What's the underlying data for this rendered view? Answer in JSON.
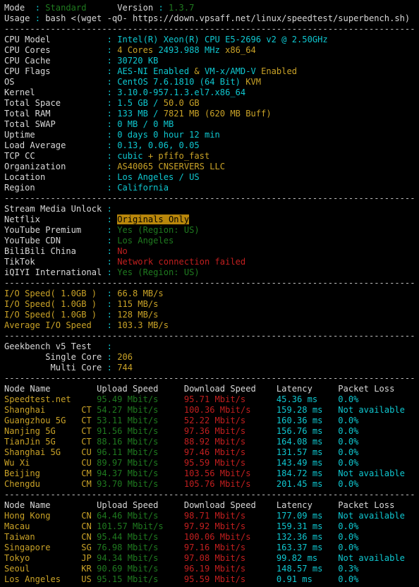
{
  "terminal": {
    "separator": "--------------------------------------------------------------------------------",
    "header": {
      "mode_label": "Mode  ",
      "mode_value": "Standard",
      "version_label": "Version ",
      "version_value": "1.3.7",
      "usage_label": "Usage ",
      "usage_value": "bash <(wget -qO- https://down.vpsaff.net/linux/speedtest/superbench.sh)"
    },
    "system": {
      "rows": [
        {
          "label": "CPU Model",
          "segments": [
            {
              "text": "Intel(R) Xeon(R) CPU E5-2696 v2 @ 2.50GHz",
              "color": "cyan"
            }
          ]
        },
        {
          "label": "CPU Cores",
          "segments": [
            {
              "text": "4 Cores ",
              "color": "yellow"
            },
            {
              "text": "2493.988 MHz ",
              "color": "cyan"
            },
            {
              "text": "x86_64",
              "color": "yellow"
            }
          ]
        },
        {
          "label": "CPU Cache",
          "segments": [
            {
              "text": "30720 KB",
              "color": "cyan"
            }
          ]
        },
        {
          "label": "CPU Flags",
          "segments": [
            {
              "text": "AES-NI Enabled ",
              "color": "cyan"
            },
            {
              "text": "& ",
              "color": "yellow"
            },
            {
              "text": "VM-x/AMD-V ",
              "color": "cyan"
            },
            {
              "text": "Enabled",
              "color": "yellow"
            }
          ]
        },
        {
          "label": "OS",
          "segments": [
            {
              "text": "CentOS 7.6.1810 (64 Bit) ",
              "color": "cyan"
            },
            {
              "text": "KVM",
              "color": "yellow"
            }
          ]
        },
        {
          "label": "Kernel",
          "segments": [
            {
              "text": "3.10.0-957.1.3.el7.x86_64",
              "color": "cyan"
            }
          ]
        },
        {
          "label": "Total Space",
          "segments": [
            {
              "text": "1.5 GB ",
              "color": "cyan"
            },
            {
              "text": "/ ",
              "color": "cyan"
            },
            {
              "text": "50.0 GB",
              "color": "yellow"
            }
          ]
        },
        {
          "label": "Total RAM",
          "segments": [
            {
              "text": "133 MB ",
              "color": "cyan"
            },
            {
              "text": "/ ",
              "color": "cyan"
            },
            {
              "text": "7821 MB ",
              "color": "yellow"
            },
            {
              "text": "(620 MB Buff)",
              "color": "yellow"
            }
          ]
        },
        {
          "label": "Total SWAP",
          "segments": [
            {
              "text": "0 MB / 0 MB",
              "color": "cyan"
            }
          ]
        },
        {
          "label": "Uptime",
          "segments": [
            {
              "text": "0 days 0 hour 12 min",
              "color": "cyan"
            }
          ]
        },
        {
          "label": "Load Average",
          "segments": [
            {
              "text": "0.13, 0.06, 0.05",
              "color": "cyan"
            }
          ]
        },
        {
          "label": "TCP CC",
          "segments": [
            {
              "text": "cubic ",
              "color": "cyan"
            },
            {
              "text": "+ pfifo_fast",
              "color": "yellow"
            }
          ]
        },
        {
          "label": "Organization",
          "segments": [
            {
              "text": "AS40065 CNSERVERS LLC",
              "color": "yellow"
            }
          ]
        },
        {
          "label": "Location",
          "segments": [
            {
              "text": "Los Angeles / US",
              "color": "cyan"
            }
          ]
        },
        {
          "label": "Region",
          "segments": [
            {
              "text": "California",
              "color": "cyan"
            }
          ]
        }
      ]
    },
    "stream": {
      "title": "Stream Media Unlock",
      "rows": [
        {
          "label": "Netflix",
          "segments": [
            {
              "text": "Originals Only",
              "color": "highlight"
            }
          ]
        },
        {
          "label": "YouTube Premium",
          "segments": [
            {
              "text": "Yes (Region: US)",
              "color": "green"
            }
          ]
        },
        {
          "label": "YouTube CDN",
          "segments": [
            {
              "text": "Los Angeles",
              "color": "green"
            }
          ]
        },
        {
          "label": "BiliBili China",
          "segments": [
            {
              "text": "No",
              "color": "red"
            }
          ]
        },
        {
          "label": "TikTok",
          "segments": [
            {
              "text": "Network connection failed",
              "color": "red"
            }
          ]
        },
        {
          "label": "iQIYI International",
          "segments": [
            {
              "text": "Yes (Region: US)",
              "color": "green"
            }
          ]
        }
      ]
    },
    "io": {
      "rows": [
        {
          "label": "I/O Speed( 1.0GB )",
          "value": "66.8 MB/s"
        },
        {
          "label": "I/O Speed( 1.0GB )",
          "value": "115 MB/s"
        },
        {
          "label": "I/O Speed( 1.0GB )",
          "value": "128 MB/s"
        },
        {
          "label": "Average I/O Speed",
          "value": "103.3 MB/s"
        }
      ]
    },
    "geekbench": {
      "title": "Geekbench v5 Test",
      "rows": [
        {
          "label": "Single Core",
          "value": "206"
        },
        {
          "label": "Multi Core",
          "value": "744"
        }
      ]
    },
    "speedtest_china": {
      "headers": {
        "node": "Node Name",
        "upload": "Upload Speed",
        "download": "Download Speed",
        "latency": "Latency",
        "loss": "Packet Loss"
      },
      "rows": [
        {
          "node": "Speedtest.net",
          "isp": "",
          "upload": "95.49 Mbit/s",
          "download": "95.71 Mbit/s",
          "latency": "45.36 ms",
          "loss": "0.0%"
        },
        {
          "node": "Shanghai",
          "isp": "CT",
          "upload": "54.27 Mbit/s",
          "download": "100.36 Mbit/s",
          "latency": "159.28 ms",
          "loss": "Not available"
        },
        {
          "node": "Guangzhou 5G",
          "isp": "CT",
          "upload": "53.11 Mbit/s",
          "download": "52.22 Mbit/s",
          "latency": "160.36 ms",
          "loss": "0.0%"
        },
        {
          "node": "Nanjing 5G",
          "isp": "CT",
          "upload": "91.56 Mbit/s",
          "download": "97.36 Mbit/s",
          "latency": "156.76 ms",
          "loss": "0.0%"
        },
        {
          "node": "TianJin 5G",
          "isp": "CT",
          "upload": "88.16 Mbit/s",
          "download": "88.92 Mbit/s",
          "latency": "164.08 ms",
          "loss": "0.0%"
        },
        {
          "node": "Shanghai 5G",
          "isp": "CU",
          "upload": "96.11 Mbit/s",
          "download": "97.46 Mbit/s",
          "latency": "131.57 ms",
          "loss": "0.0%"
        },
        {
          "node": "Wu Xi",
          "isp": "CU",
          "upload": "89.97 Mbit/s",
          "download": "95.59 Mbit/s",
          "latency": "143.49 ms",
          "loss": "0.0%"
        },
        {
          "node": "Beijing",
          "isp": "CM",
          "upload": "94.37 Mbit/s",
          "download": "103.56 Mbit/s",
          "latency": "184.72 ms",
          "loss": "Not available"
        },
        {
          "node": "Chengdu",
          "isp": "CM",
          "upload": "93.70 Mbit/s",
          "download": "105.76 Mbit/s",
          "latency": "201.45 ms",
          "loss": "0.0%"
        }
      ]
    },
    "speedtest_intl": {
      "headers": {
        "node": "Node Name",
        "upload": "Upload Speed",
        "download": "Download Speed",
        "latency": "Latency",
        "loss": "Packet Loss"
      },
      "rows": [
        {
          "node": "Hong Kong",
          "isp": "CN",
          "upload": "64.46 Mbit/s",
          "download": "98.71 Mbit/s",
          "latency": "177.09 ms",
          "loss": "Not available"
        },
        {
          "node": "Macau",
          "isp": "CN",
          "upload": "101.57 Mbit/s",
          "download": "97.92 Mbit/s",
          "latency": "159.31 ms",
          "loss": "0.0%"
        },
        {
          "node": "Taiwan",
          "isp": "CN",
          "upload": "95.44 Mbit/s",
          "download": "100.06 Mbit/s",
          "latency": "132.36 ms",
          "loss": "0.0%"
        },
        {
          "node": "Singapore",
          "isp": "SG",
          "upload": "76.98 Mbit/s",
          "download": "97.16 Mbit/s",
          "latency": "163.37 ms",
          "loss": "0.0%"
        },
        {
          "node": "Tokyo",
          "isp": "JP",
          "upload": "94.34 Mbit/s",
          "download": "97.08 Mbit/s",
          "latency": "99.82 ms",
          "loss": "Not available"
        },
        {
          "node": "Seoul",
          "isp": "KR",
          "upload": "90.69 Mbit/s",
          "download": "96.19 Mbit/s",
          "latency": "148.57 ms",
          "loss": "0.3%"
        },
        {
          "node": "Los Angeles",
          "isp": "US",
          "upload": "95.15 Mbit/s",
          "download": "95.59 Mbit/s",
          "latency": "0.91 ms",
          "loss": "0.0%"
        }
      ]
    },
    "colors": {
      "background": "#000000",
      "label": "#d8d8d8",
      "cyan": "#0fc7d0",
      "yellow": "#c9a227",
      "green": "#0a7d24",
      "red": "#c21f1f",
      "highlight_bg": "#b8860b"
    }
  }
}
